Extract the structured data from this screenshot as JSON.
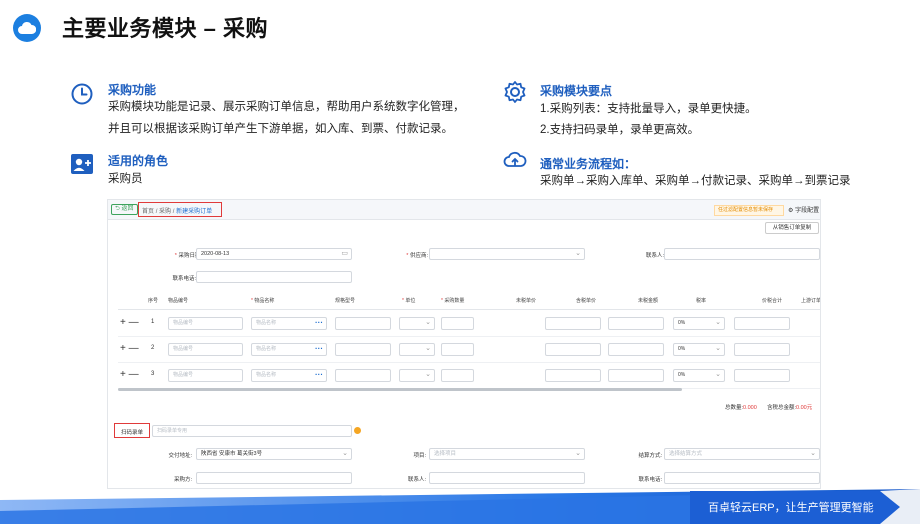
{
  "header": {
    "title": "主要业务模块 – 采购"
  },
  "sections": {
    "function": {
      "heading": "采购功能",
      "line1": "采购模块功能是记录、展示采购订单信息，帮助用户系统数字化管理，",
      "line2": "并且可以根据该采购订单产生下游单据，如入库、到票、付款记录。"
    },
    "role": {
      "heading": "适用的角色",
      "line1": "采购员"
    },
    "points": {
      "heading": "采购模块要点",
      "line1": "1.采购列表：支持批量导入，录单更快捷。",
      "line2": "2.支持扫码录单，录单更高效。"
    },
    "flow": {
      "heading": "通常业务流程如：",
      "line1": "采购单→采购入库单、采购单→付款记录、采购单→到票记录"
    }
  },
  "screenshot": {
    "back_label": "返回",
    "breadcrumb": {
      "home": "首页",
      "sep": "/",
      "module": "采购",
      "current": "新建采购订单"
    },
    "warning": "任过滤配置信息暂未保存",
    "field_settings": "字段配置",
    "copy_button": "从销售订单复制",
    "form": {
      "date_label": "采购日期:",
      "date_value": "2020-08-13",
      "supplier_label": "供应商:",
      "contact_label": "联系人:",
      "phone_label": "联系电话:"
    },
    "table": {
      "headers": [
        "序号",
        "物品编号",
        "物品名称",
        "规格型号",
        "单位",
        "采购数量",
        "未税单价",
        "含税单价",
        "未税金额",
        "税率",
        "价税合计",
        "上游订单"
      ],
      "rows": [
        {
          "seq": "1",
          "code_ph": "物品编号",
          "name_ph": "物品名称",
          "tax": "0%"
        },
        {
          "seq": "2",
          "code_ph": "物品编号",
          "name_ph": "物品名称",
          "tax": "0%"
        },
        {
          "seq": "3",
          "code_ph": "物品编号",
          "name_ph": "物品名称",
          "tax": "0%"
        }
      ],
      "row_actions": "+ —"
    },
    "totals": {
      "qty_label": "总数量:",
      "qty_value": "0.000",
      "amount_label": "含税总金额:",
      "amount_value": "0.00元"
    },
    "scan": {
      "label": "扫码录单",
      "placeholder": "扫码录单专用"
    },
    "bottom_form": {
      "address_label": "交付地址:",
      "address_value": "陕西省 安康市 葛关街3号",
      "project_label": "项目:",
      "project_ph": "选择项目",
      "settle_label": "结算方式:",
      "settle_ph": "选择结算方式",
      "buyer_label": "采购方:",
      "contact2_label": "联系人:",
      "phone2_label": "联系电话:"
    }
  },
  "footer": {
    "slogan": "百卓轻云ERP，让生产管理更智能"
  },
  "colors": {
    "accent": "#1f5fbf",
    "brand_blue": "#1c7fe0",
    "highlight_red": "#e03a3a",
    "band": "#1e6fe0"
  }
}
